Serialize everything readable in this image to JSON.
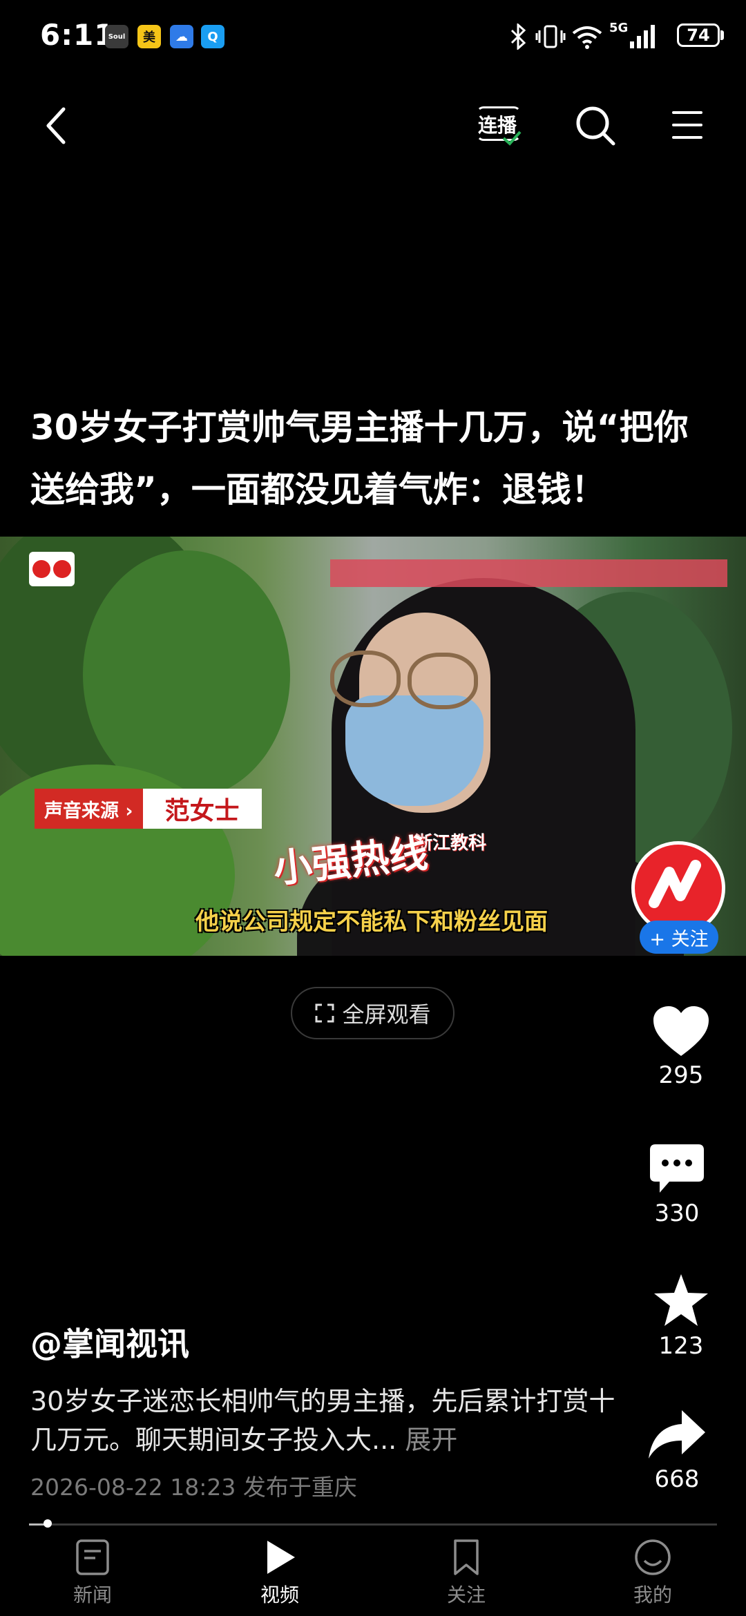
{
  "status": {
    "time": "6:11",
    "app_icons": [
      {
        "name": "soul-app-icon",
        "label": "Soul",
        "bg": "#3a3a3a"
      },
      {
        "name": "meituan-app-icon",
        "label": "美",
        "bg": "#f5c518"
      },
      {
        "name": "weather-app-icon",
        "label": "☁",
        "bg": "#2f7be8"
      },
      {
        "name": "search-app-icon",
        "label": "Q",
        "bg": "#1a9ef2"
      }
    ],
    "network": "5G",
    "battery": "74"
  },
  "header": {
    "continuous_play_label": "连播"
  },
  "article": {
    "title": "30岁女子打赏帅气男主播十几万，说“把你送给我”，一面都没见着气炸：退钱！"
  },
  "video": {
    "source_label": "声音来源 ›",
    "source_name": "范女士",
    "channel_badge": "小强热线",
    "channel_badge_sub": "浙江教科",
    "subtitle": "他说公司规定不能私下和粉丝见面",
    "follow_label": "+ 关注"
  },
  "fullscreen": {
    "label": "全屏观看"
  },
  "actions": {
    "likes": "295",
    "comments": "330",
    "favorites": "123",
    "shares": "668"
  },
  "info": {
    "author": "@掌闻视讯",
    "description": "30岁女子迷恋长相帅气的男主播，先后累计打赏十几万元。聊天期间女子投入大...",
    "expand_label": "展开",
    "meta": "2026-08-22 18:23 发布于重庆"
  },
  "progress": {
    "fraction": 0.027
  },
  "nav": [
    {
      "key": "news",
      "label": "新闻"
    },
    {
      "key": "video",
      "label": "视频"
    },
    {
      "key": "follow",
      "label": "关注"
    },
    {
      "key": "mine",
      "label": "我的"
    }
  ],
  "colors": {
    "accent_blue": "#1a76e8",
    "brand_red": "#e8232a",
    "subtitle_yellow": "#f5d04a"
  }
}
